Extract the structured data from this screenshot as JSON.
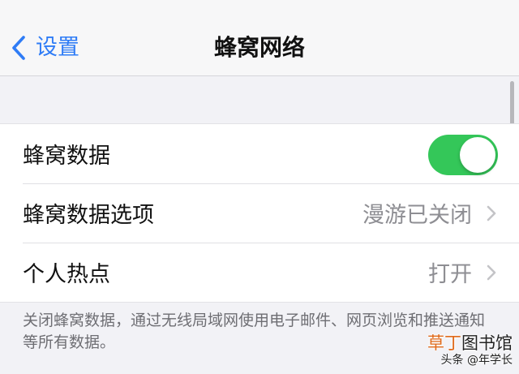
{
  "nav": {
    "back_label": "设置",
    "title": "蜂窝网络"
  },
  "rows": [
    {
      "label": "蜂窝数据",
      "toggle_on": true
    },
    {
      "label": "蜂窝数据选项",
      "value": "漫游已关闭"
    },
    {
      "label": "个人热点",
      "value": "打开"
    }
  ],
  "footer": {
    "text": "关闭蜂窝数据，通过无线局域网使用电子邮件、网页浏览和推送通知等所有数据。"
  },
  "watermark": {
    "line1_accent": "草丁",
    "line1_rest": "图书馆",
    "line2": "头条 @年学长"
  },
  "colors": {
    "accent": "#2f7cf6",
    "toggle_on": "#34c759",
    "background": "#f2f2f6"
  },
  "icons": {
    "back": "chevron-left-icon",
    "disclosure": "chevron-right-icon"
  }
}
